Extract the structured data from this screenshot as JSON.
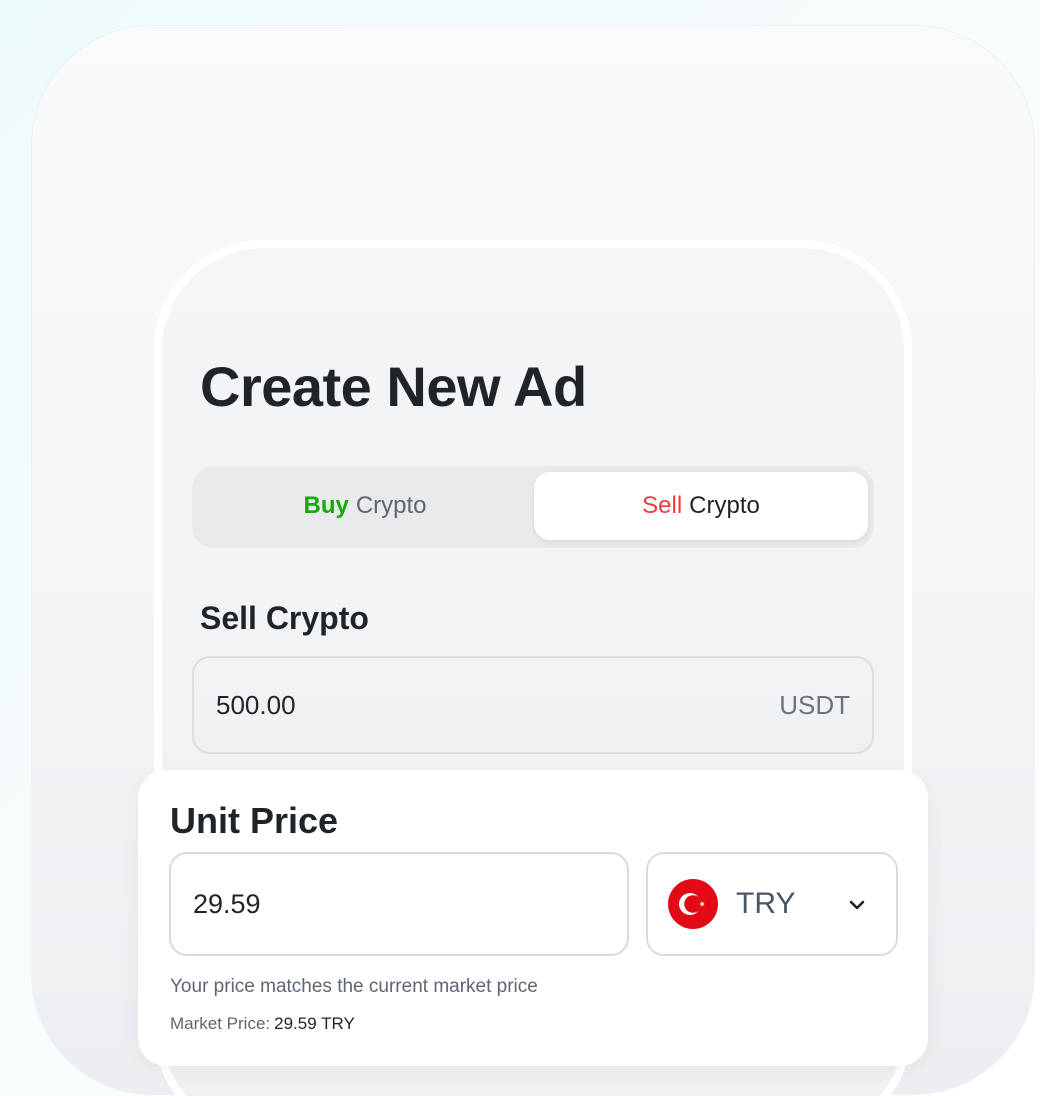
{
  "header": {
    "title": "Create New Ad"
  },
  "toggle": {
    "buy": {
      "keyword": "Buy",
      "label": "Crypto"
    },
    "sell": {
      "keyword": "Sell",
      "label": "Crypto"
    },
    "selected": "sell"
  },
  "sell_section": {
    "title": "Sell Crypto",
    "amount_value": "500.00",
    "amount_unit": "USDT"
  },
  "unit_price": {
    "title": "Unit Price",
    "value": "29.59",
    "currency": "TRY",
    "hint": "Your price matches the current market price",
    "market_label": "Market Price:",
    "market_value": "29.59 TRY"
  },
  "icons": {
    "flag": "turkey-flag-icon",
    "dropdown": "chevron-down-icon"
  },
  "colors": {
    "buy_accent": "#1aa60e",
    "sell_accent": "#ef3b3b",
    "flag_red": "#e30a17"
  }
}
